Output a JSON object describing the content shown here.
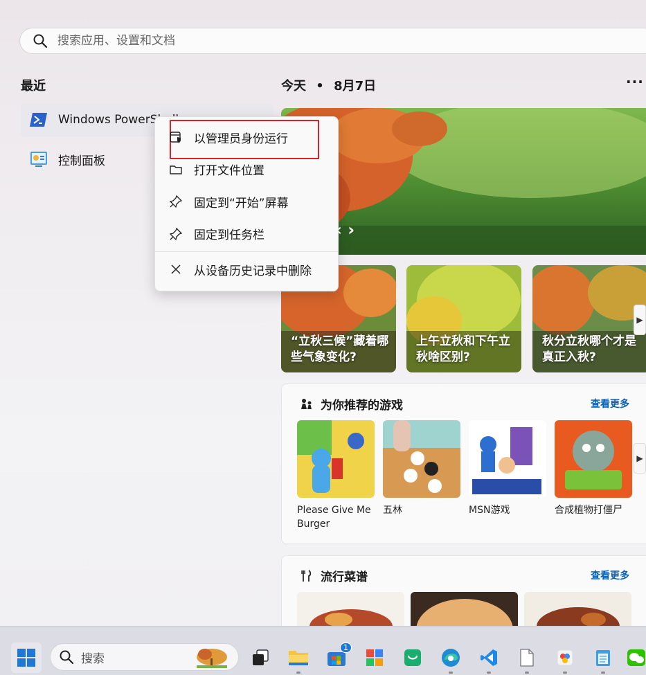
{
  "search": {
    "placeholder": "搜索应用、设置和文档"
  },
  "recent": {
    "title": "最近",
    "items": [
      {
        "label": "Windows PowerShell"
      },
      {
        "label": "控制面板"
      }
    ]
  },
  "context_menu": {
    "items": [
      {
        "label": "以管理员身份运行",
        "icon": "admin-shield-icon"
      },
      {
        "label": "打开文件位置",
        "icon": "folder-icon"
      },
      {
        "label": "固定到“开始”屏幕",
        "icon": "pin-icon"
      },
      {
        "label": "固定到任务栏",
        "icon": "pin-icon"
      },
      {
        "label": "从设备历史记录中删除",
        "icon": "close-icon"
      }
    ]
  },
  "today": {
    "label": "今天",
    "separator": "•",
    "date": "8月7日",
    "more": "···"
  },
  "cards": [
    {
      "caption": "“立秋三候”藏着哪些气象变化?"
    },
    {
      "caption": "上午立秋和下午立秋啥区别?"
    },
    {
      "caption": "秋分立秋哪个才是真正入秋?"
    }
  ],
  "games_section": {
    "title": "为你推荐的游戏",
    "see_more": "查看更多",
    "items": [
      {
        "name": "Please Give Me Burger"
      },
      {
        "name": "五林"
      },
      {
        "name": "MSN游戏"
      },
      {
        "name": "合成植物打僵尸"
      }
    ]
  },
  "recipes_section": {
    "title": "流行菜谱",
    "see_more": "查看更多"
  },
  "taskbar": {
    "search_label": "搜索",
    "store_badge": "1"
  },
  "colors": {
    "highlight": "#d8232a",
    "link": "#0a5fb4"
  }
}
